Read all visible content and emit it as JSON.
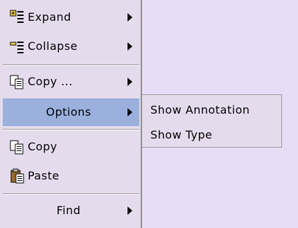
{
  "menu": {
    "items": [
      {
        "label": "Expand",
        "icon": "expand-icon",
        "has_submenu": true
      },
      {
        "label": "Collapse",
        "icon": "collapse-icon",
        "has_submenu": true
      },
      {
        "label": "Copy ...",
        "icon": "copy-icon",
        "has_submenu": true
      },
      {
        "label": "Options",
        "icon": "",
        "has_submenu": true,
        "selected": true
      },
      {
        "label": "Copy",
        "icon": "copy-icon",
        "has_submenu": false
      },
      {
        "label": "Paste",
        "icon": "paste-icon",
        "has_submenu": false
      },
      {
        "label": "Find",
        "icon": "",
        "has_submenu": true
      }
    ]
  },
  "submenu": {
    "items": [
      {
        "label": "Show Annotation"
      },
      {
        "label": "Show Type"
      }
    ]
  },
  "colors": {
    "menu_bg": "#e4dced",
    "selected_bg": "#9bb0dd",
    "page_bg": "#e8dcf7"
  }
}
